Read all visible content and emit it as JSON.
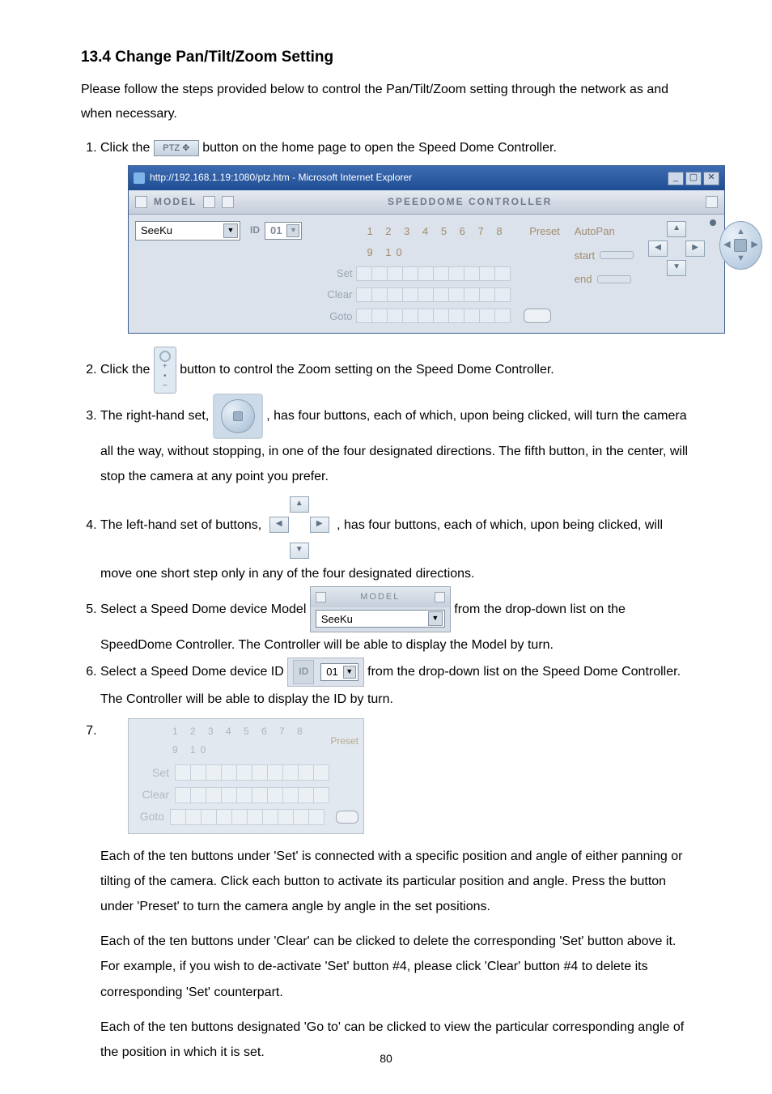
{
  "heading": "13.4 Change Pan/Tilt/Zoom Setting",
  "intro": "Please follow the steps provided below to control the Pan/Tilt/Zoom setting through the network as and when necessary.",
  "page_number": "80",
  "step1": {
    "pre": "Click the ",
    "btn": "PTZ ✥",
    "post": " button on the home page to open the Speed Dome Controller."
  },
  "ie_window": {
    "title": "http://192.168.1.19:1080/ptz.htm - Microsoft Internet Explorer",
    "min": "_",
    "max": "▢",
    "close": "✕",
    "bar_model": "MODEL",
    "bar_right": "SPEEDDOME CONTROLLER",
    "model_value": "SeeKu",
    "id_label": "ID",
    "id_value": "01",
    "numbers": "1 2 3 4 5 6 7 8 9 10",
    "preset_label": "Preset",
    "autopan_label": "AutoPan",
    "autopan_start": "start",
    "autopan_end": "end",
    "row_set": "Set",
    "row_clear": "Clear",
    "row_goto": "Goto"
  },
  "step2": "button to control the Zoom setting on the Speed Dome Controller.",
  "step2_pre": "Click the ",
  "step3_pre": "The right-hand set, ",
  "step3_post": ", has four buttons, each of which, upon being clicked, will turn the camera all the way, without stopping, in one of the four designated directions. The fifth button, in the center, will stop the camera at any point you prefer.",
  "step4_pre": "The left-hand set of buttons, ",
  "step4_post": ", has four buttons, each of which, upon being clicked, will move one short step only in any of the four designated directions.",
  "step5": {
    "pre": "Select a Speed Dome device Model ",
    "post": " from the drop-down list on the SpeedDome Controller. The Controller will be able to display the Model by turn.",
    "hdr": "MODEL",
    "value": "SeeKu"
  },
  "step6": {
    "pre": "Select a Speed Dome device ID ",
    "post": " from the drop-down list on the Speed Dome Controller. The Controller will be able to display the ID by turn.",
    "id_label": "ID",
    "id_value": "01"
  },
  "step7_table": {
    "numbers": "1 2 3 4 5 6 7 8 9 10",
    "preset": "Preset",
    "set": "Set",
    "clear": "Clear",
    "goto": "Goto"
  },
  "step7_p1": "Each of the ten buttons under 'Set' is connected with a specific position and angle of either panning or tilting of the camera. Click each button to activate its particular position and angle. Press the button under 'Preset' to turn the camera angle by angle in the set positions.",
  "step7_p2": "Each of the ten buttons under 'Clear' can be clicked to delete the corresponding 'Set' button above it. For example, if you wish to de-activate 'Set' button #4, please click 'Clear' button #4 to delete its corresponding 'Set' counterpart.",
  "step7_p3": "Each of the ten buttons designated 'Go to' can be clicked to view the particular corresponding angle of the position in which it is set."
}
